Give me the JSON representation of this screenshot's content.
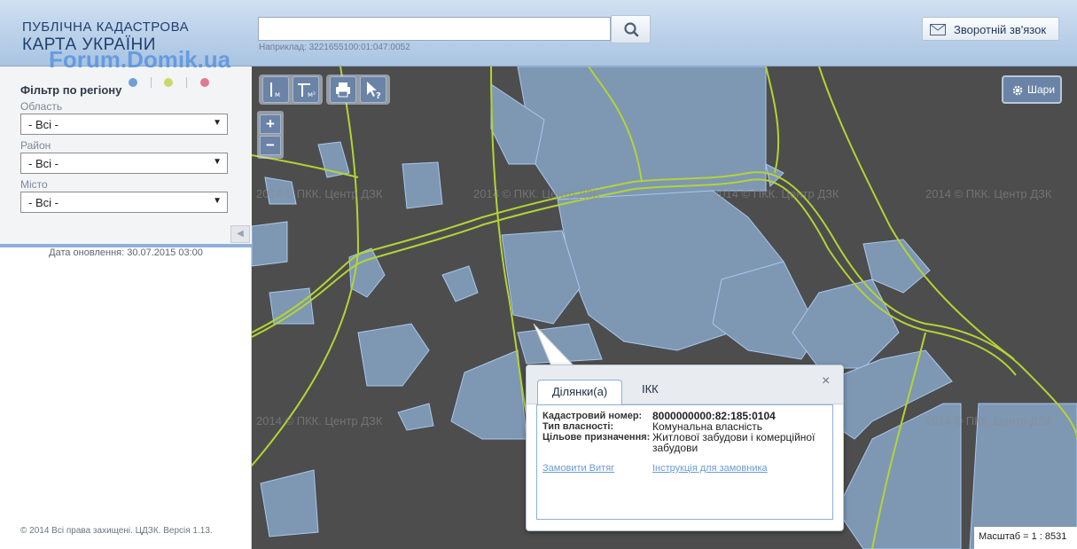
{
  "header": {
    "logo_line1": "ПУБЛІЧНА КАДАСТРОВА",
    "logo_line2": "КАРТА УКРАЇНИ",
    "watermark": "Forum.Domik.ua",
    "search_value": "",
    "search_hint": "Наприклад: 3221655100:01:047:0052",
    "feedback_label": "Зворотній зв'язок"
  },
  "sidebar": {
    "filter_title": "Фільтр по регіону",
    "fields": [
      {
        "label": "Область",
        "value": "- Всі -"
      },
      {
        "label": "Район",
        "value": "- Всі -"
      },
      {
        "label": "Місто",
        "value": "- Всі -"
      }
    ],
    "update_date": "Дата оновлення: 30.07.2015 03:00",
    "copyright": "© 2014 Всі права захищені. ЦДЗК. Версія 1.13.",
    "dot_colors": [
      "#6ea0d4",
      "#cdd86a",
      "#e07a92"
    ]
  },
  "map": {
    "layers_label": "Шари",
    "scale_label": "Масштаб = 1 : 8531",
    "tile_watermark": "2014 © ПКК. Центр ДЗК",
    "colors": {
      "background": "#4d4d4d",
      "parcel_fill": "#7e97b3",
      "parcel_stroke": "#a9c8ee",
      "road_stroke": "#b4d434"
    }
  },
  "popup": {
    "tabs": [
      "Ділянки(а)",
      "ІКК"
    ],
    "active_tab": "Ділянки(а)",
    "close_symbol": "×",
    "attributes": [
      {
        "key": "Кадастровий номер:",
        "value": "8000000000:82:185:0104"
      },
      {
        "key": "Тип власності:",
        "value": "Комунальна власність"
      },
      {
        "key": "Цільове призначення:",
        "value": "Житлової забудови і комерційної забудови"
      }
    ],
    "links": [
      "Замовити Витяг",
      "Інструкція для замовника"
    ]
  }
}
